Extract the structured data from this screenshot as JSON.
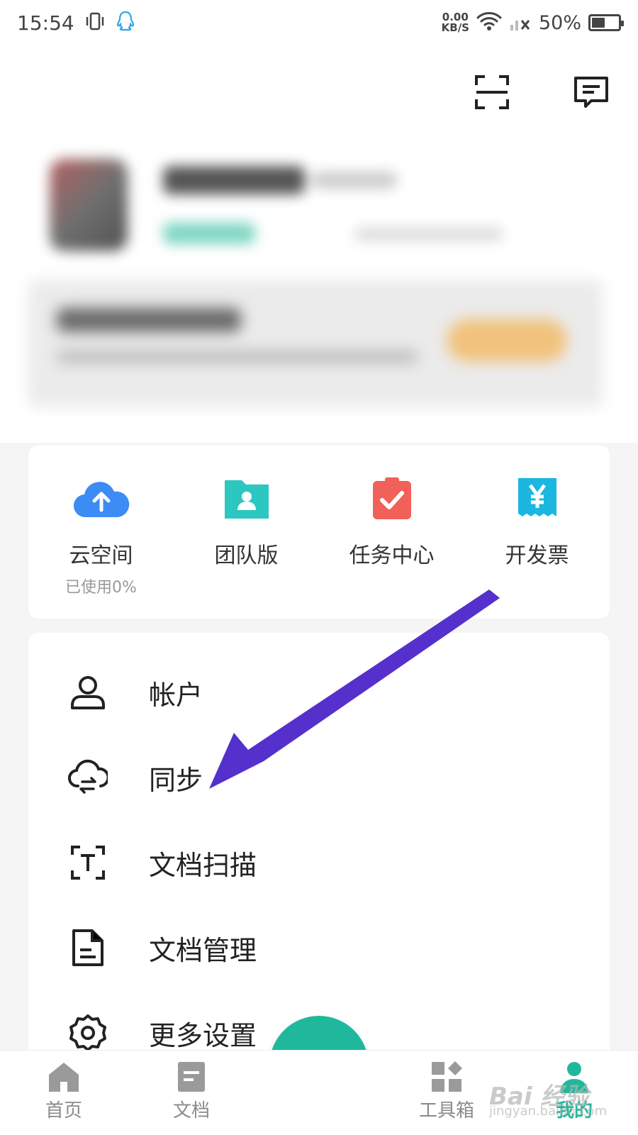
{
  "status_bar": {
    "time": "15:54",
    "net_speed_value": "0.00",
    "net_speed_unit": "KB/S",
    "battery": "50%",
    "battery_level": 0.5
  },
  "quick_actions": [
    {
      "label": "云空间",
      "sub": "已使用0%",
      "icon": "cloud-upload-icon",
      "color": "#3d8bf5"
    },
    {
      "label": "团队版",
      "icon": "team-folder-icon",
      "color": "#2cc7c0"
    },
    {
      "label": "任务中心",
      "icon": "task-check-icon",
      "color": "#f2605a"
    },
    {
      "label": "开发票",
      "icon": "invoice-yen-icon",
      "color": "#1bb7e0"
    }
  ],
  "menu": [
    {
      "label": "帐户",
      "icon": "person-icon"
    },
    {
      "label": "同步",
      "icon": "cloud-sync-icon"
    },
    {
      "label": "文档扫描",
      "icon": "text-scan-icon"
    },
    {
      "label": "文档管理",
      "icon": "document-icon"
    },
    {
      "label": "更多设置",
      "icon": "gear-icon"
    }
  ],
  "bottom_nav": [
    {
      "label": "首页",
      "icon": "home-icon",
      "active": false
    },
    {
      "label": "文档",
      "icon": "document-tab-icon",
      "active": false
    },
    {
      "label": "",
      "icon": "camera-icon",
      "active": false
    },
    {
      "label": "工具箱",
      "icon": "toolbox-icon",
      "active": false
    },
    {
      "label": "我的",
      "icon": "profile-icon",
      "active": true
    }
  ],
  "colors": {
    "accent": "#20b89c",
    "arrow": "#5530cc"
  },
  "watermark": {
    "main": "Bai 经验",
    "sub": "jingyan.baidu.com"
  }
}
